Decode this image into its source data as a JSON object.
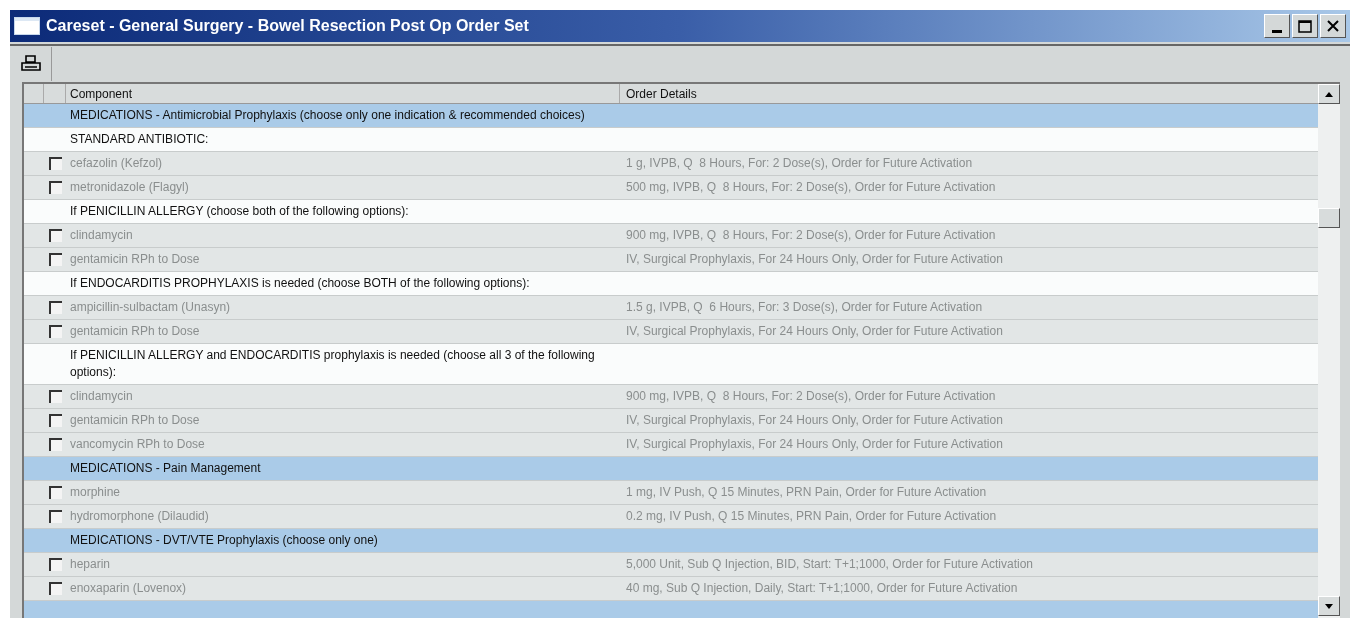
{
  "window": {
    "title": "Careset - General Surgery - Bowel Resection Post Op Order Set"
  },
  "table": {
    "columns": [
      "Component",
      "Order Details"
    ],
    "rows": [
      {
        "kind": "section",
        "component": "MEDICATIONS - Antimicrobial Prophylaxis (choose only one indication & recommended choices)"
      },
      {
        "kind": "heading",
        "component": "STANDARD ANTIBIOTIC:"
      },
      {
        "kind": "order",
        "checked": false,
        "component": "cefazolin (Kefzol)",
        "details": "1 g, IVPB, Q  8 Hours, For: 2 Dose(s), Order for Future Activation"
      },
      {
        "kind": "order",
        "checked": false,
        "component": "metronidazole (Flagyl)",
        "details": "500 mg, IVPB, Q  8 Hours, For: 2 Dose(s), Order for Future Activation"
      },
      {
        "kind": "heading",
        "component": "If PENICILLIN ALLERGY (choose both of the following options):"
      },
      {
        "kind": "order",
        "checked": false,
        "component": "clindamycin",
        "details": "900 mg, IVPB, Q  8 Hours, For: 2 Dose(s), Order for Future Activation"
      },
      {
        "kind": "order",
        "checked": false,
        "component": "gentamicin RPh to Dose",
        "details": "IV, Surgical Prophylaxis, For 24 Hours Only, Order for Future Activation"
      },
      {
        "kind": "heading",
        "component": "If ENDOCARDITIS PROPHYLAXIS is needed (choose BOTH of the following options):"
      },
      {
        "kind": "order",
        "checked": false,
        "component": "ampicillin-sulbactam (Unasyn)",
        "details": "1.5 g, IVPB, Q  6 Hours, For: 3 Dose(s), Order for Future Activation"
      },
      {
        "kind": "order",
        "checked": false,
        "component": "gentamicin RPh to Dose",
        "details": "IV, Surgical Prophylaxis, For 24 Hours Only, Order for Future Activation"
      },
      {
        "kind": "heading",
        "component": "If PENICILLIN ALLERGY and ENDOCARDITIS prophylaxis is needed (choose all 3 of the following options):"
      },
      {
        "kind": "order",
        "checked": false,
        "component": "clindamycin",
        "details": "900 mg, IVPB, Q  8 Hours, For: 2 Dose(s), Order for Future Activation"
      },
      {
        "kind": "order",
        "checked": false,
        "component": "gentamicin RPh to Dose",
        "details": "IV, Surgical Prophylaxis, For 24 Hours Only, Order for Future Activation"
      },
      {
        "kind": "order",
        "checked": false,
        "component": "vancomycin RPh to Dose",
        "details": "IV, Surgical Prophylaxis, For 24 Hours Only, Order for Future Activation"
      },
      {
        "kind": "section",
        "component": "MEDICATIONS - Pain Management"
      },
      {
        "kind": "order",
        "checked": false,
        "component": "morphine",
        "details": "1 mg, IV Push, Q 15 Minutes, PRN Pain, Order for Future Activation"
      },
      {
        "kind": "order",
        "checked": false,
        "component": "hydromorphone (Dilaudid)",
        "details": "0.2 mg, IV Push, Q 15 Minutes, PRN Pain, Order for Future Activation"
      },
      {
        "kind": "section",
        "component": "MEDICATIONS - DVT/VTE Prophylaxis (choose only one)"
      },
      {
        "kind": "order",
        "checked": false,
        "component": "heparin",
        "details": "5,000 Unit, Sub Q Injection, BID, Start: T+1;1000, Order for Future Activation"
      },
      {
        "kind": "order",
        "checked": false,
        "component": "enoxaparin (Lovenox)",
        "details": "40 mg, Sub Q Injection, Daily, Start: T+1;1000, Order for Future Activation"
      },
      {
        "kind": "section"
      }
    ]
  }
}
